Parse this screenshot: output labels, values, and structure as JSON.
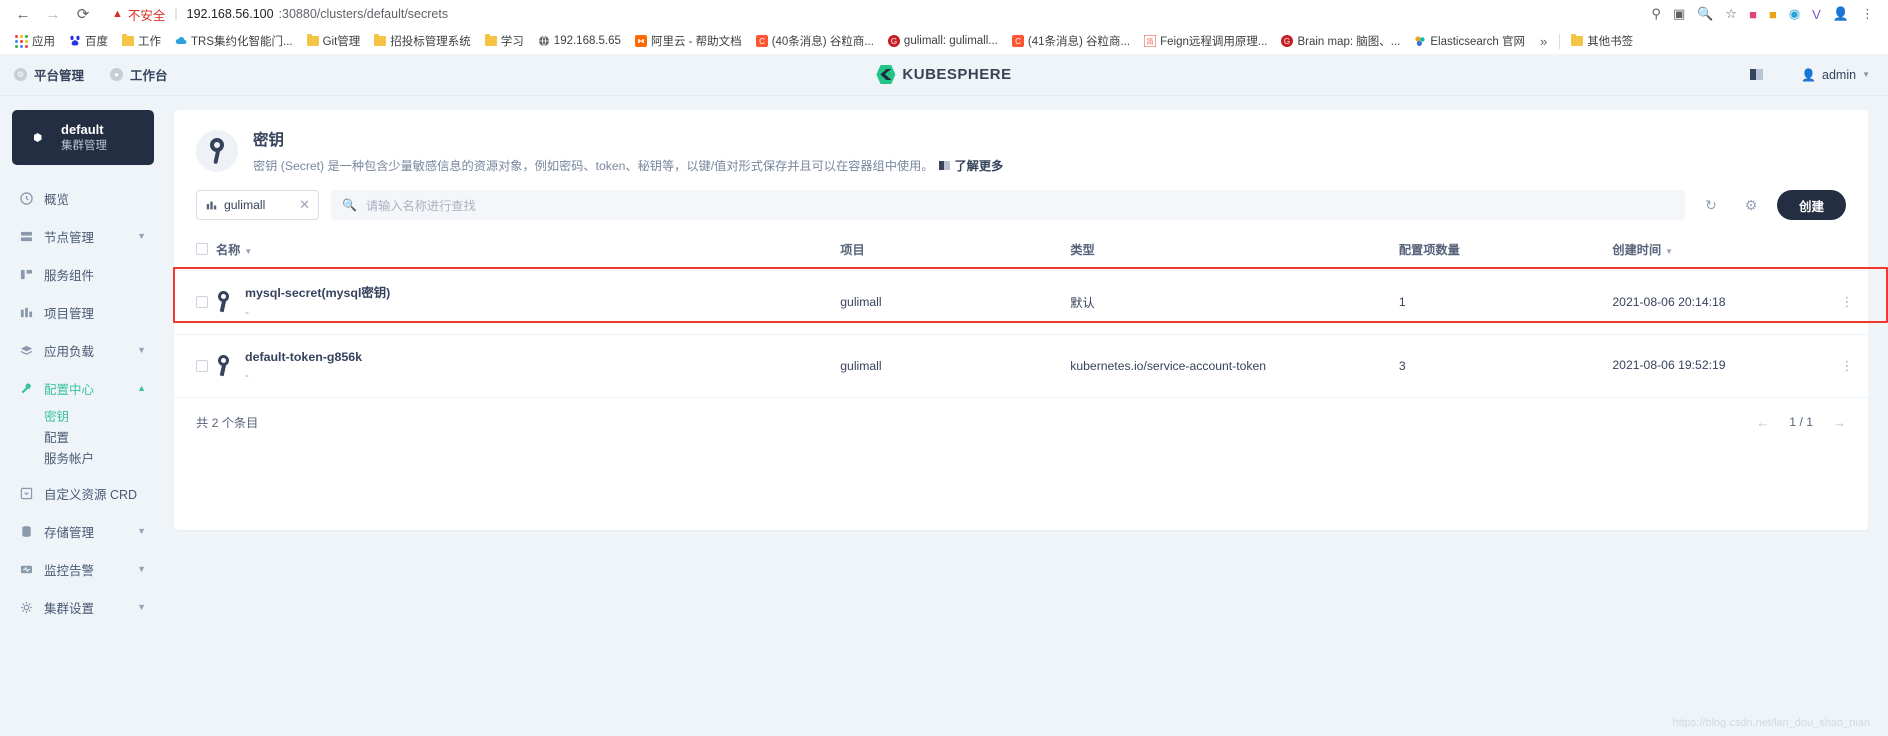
{
  "browser": {
    "back_icon": "back-arrow-icon",
    "forward_icon": "forward-arrow-icon",
    "reload_icon": "reload-icon",
    "security_warning": "不安全",
    "url_host": "192.168.56.100",
    "url_rest": ":30880/clusters/default/secrets",
    "bookmarks": [
      {
        "label": "应用",
        "icon": "apps-grid-icon",
        "color": "#4285f4"
      },
      {
        "label": "百度",
        "icon": "baidu-icon",
        "color": "#2932e1"
      },
      {
        "label": "工作",
        "icon": "folder-icon",
        "color": "#f6c445"
      },
      {
        "label": "TRS集约化智能门...",
        "icon": "cloud-icon",
        "color": "#2aa3d8"
      },
      {
        "label": "Git管理",
        "icon": "folder-icon",
        "color": "#f6c445"
      },
      {
        "label": "招投标管理系统",
        "icon": "folder-icon",
        "color": "#f6c445"
      },
      {
        "label": "学习",
        "icon": "folder-icon",
        "color": "#f6c445"
      },
      {
        "label": "192.168.5.65",
        "icon": "globe-icon",
        "color": "#5f6368"
      },
      {
        "label": "阿里云 - 帮助文档",
        "icon": "aliyun-icon",
        "color": "#ff6a00"
      },
      {
        "label": "(40条消息) 谷粒商...",
        "icon": "csdn-icon",
        "color": "#fc5531"
      },
      {
        "label": "gulimall: gulimall...",
        "icon": "gitee-icon",
        "color": "#c71d23"
      },
      {
        "label": "(41条消息) 谷粒商...",
        "icon": "csdn-icon",
        "color": "#fc5531"
      },
      {
        "label": "Feign远程调用原理...",
        "icon": "jianshu-icon",
        "color": "#ea6f5a"
      },
      {
        "label": "Brain map: 脑图、...",
        "icon": "gitee-icon",
        "color": "#c71d23"
      },
      {
        "label": "Elasticsearch 官网",
        "icon": "elastic-icon",
        "color": "#00bfb3"
      }
    ],
    "overflow_label": "»",
    "other_bookmarks": "其他书签"
  },
  "header": {
    "platform_label": "平台管理",
    "workbench_label": "工作台",
    "brand": "KUBESPHERE",
    "user": "admin"
  },
  "sidebar": {
    "cluster_name": "default",
    "cluster_sub": "集群管理",
    "items": [
      {
        "label": "概览",
        "icon": "overview-icon",
        "expandable": false,
        "active": false
      },
      {
        "label": "节点管理",
        "icon": "node-icon",
        "expandable": true,
        "active": false
      },
      {
        "label": "服务组件",
        "icon": "component-icon",
        "expandable": false,
        "active": false
      },
      {
        "label": "项目管理",
        "icon": "project-icon",
        "expandable": false,
        "active": false
      },
      {
        "label": "应用负载",
        "icon": "workload-icon",
        "expandable": true,
        "active": false
      },
      {
        "label": "配置中心",
        "icon": "config-icon",
        "expandable": true,
        "active": true
      },
      {
        "label": "自定义资源 CRD",
        "icon": "crd-icon",
        "expandable": false,
        "active": false
      },
      {
        "label": "存储管理",
        "icon": "storage-icon",
        "expandable": true,
        "active": false
      },
      {
        "label": "监控告警",
        "icon": "monitor-icon",
        "expandable": true,
        "active": false
      },
      {
        "label": "集群设置",
        "icon": "settings-icon",
        "expandable": true,
        "active": false
      }
    ],
    "config_children": [
      {
        "label": "密钥",
        "active": true
      },
      {
        "label": "配置",
        "active": false
      },
      {
        "label": "服务帐户",
        "active": false
      }
    ]
  },
  "panel": {
    "title": "密钥",
    "description": "密钥 (Secret) 是一种包含少量敏感信息的资源对象，例如密码、token、秘钥等，以键/值对形式保存并且可以在容器组中使用。",
    "learn_more": "了解更多"
  },
  "toolbar": {
    "filter_chip": "gulimall",
    "search_placeholder": "请输入名称进行查找",
    "refresh_icon": "refresh-icon",
    "settings_icon": "gear-icon",
    "create_label": "创建"
  },
  "table": {
    "columns": [
      "名称",
      "项目",
      "类型",
      "配置项数量",
      "创建时间"
    ],
    "sort_column_name": "名称",
    "sort_column_time": "创建时间",
    "rows": [
      {
        "name": "mysql-secret(mysql密钥)",
        "sub": "-",
        "project": "gulimall",
        "type": "默认",
        "count": "1",
        "created": "2021-08-06 20:14:18",
        "highlighted": true
      },
      {
        "name": "default-token-g856k",
        "sub": "-",
        "project": "gulimall",
        "type": "kubernetes.io/service-account-token",
        "count": "3",
        "created": "2021-08-06 19:52:19",
        "highlighted": false
      }
    ],
    "total_label": "共 2 个条目",
    "page_label": "1 / 1"
  },
  "watermark": "https://blog.csdn.net/lan_dou_shao_nian",
  "colors": {
    "accent_green": "#3ac49a",
    "dark_navy": "#242e42",
    "highlight_red": "#f1382d",
    "warning_red": "#d93025"
  }
}
